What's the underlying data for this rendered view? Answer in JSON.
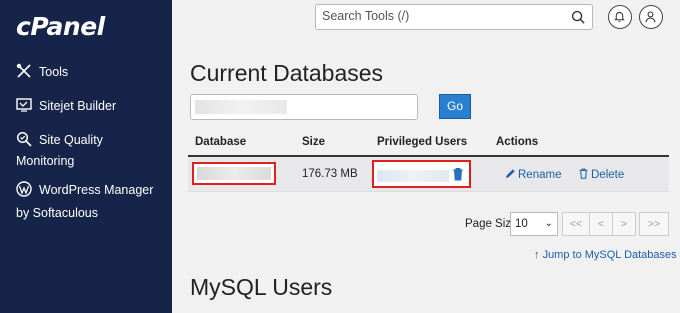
{
  "sidebar": {
    "logo": "cPanel",
    "items": [
      {
        "label": "Tools",
        "icon": "tools-icon"
      },
      {
        "label": "Sitejet Builder",
        "icon": "sitejet-icon"
      },
      {
        "label": "Site Quality",
        "label2": "Monitoring",
        "icon": "site-quality-icon"
      },
      {
        "label": "WordPress Manager",
        "label2": "by Softaculous",
        "icon": "wordpress-icon"
      }
    ]
  },
  "header": {
    "search_placeholder": "Search Tools (/)"
  },
  "main": {
    "title": "Current Databases",
    "go_label": "Go",
    "columns": [
      "Database",
      "Size",
      "Privileged Users",
      "Actions"
    ],
    "row": {
      "size": "176.73 MB",
      "rename": "Rename",
      "delete": "Delete"
    },
    "pagination": {
      "page_size_label": "Page Size",
      "page_size": "10",
      "first": "<<",
      "prev": "<",
      "next": ">",
      "last": ">>"
    },
    "jump_link": "Jump to MySQL Databases",
    "section2_title": "MySQL Users"
  },
  "colors": {
    "sidebar_bg": "#16244a",
    "accent": "#2a7fcf",
    "link": "#1a5fa8",
    "highlight_border": "#e02020"
  }
}
